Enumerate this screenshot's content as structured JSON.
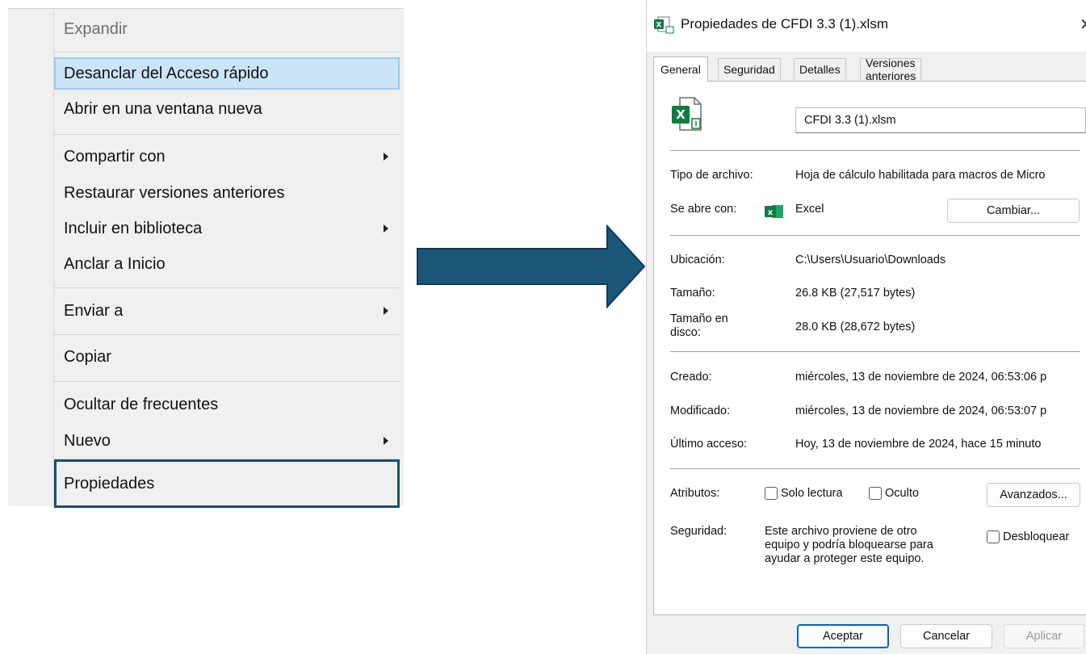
{
  "context_menu": {
    "items": [
      {
        "label": "Expandir"
      },
      {
        "label": "Desanclar del Acceso rápido"
      },
      {
        "label": "Abrir en una ventana nueva"
      },
      {
        "label": "Compartir con"
      },
      {
        "label": "Restaurar versiones anteriores"
      },
      {
        "label": "Incluir en biblioteca"
      },
      {
        "label": "Anclar a Inicio"
      },
      {
        "label": "Enviar a"
      },
      {
        "label": "Copiar"
      },
      {
        "label": "Ocultar de frecuentes"
      },
      {
        "label": "Nuevo"
      },
      {
        "label": "Propiedades"
      }
    ]
  },
  "dialog": {
    "title": "Propiedades de CFDI 3.3 (1).xlsm",
    "close_glyph": "✕",
    "tabs": [
      "General",
      "Seguridad",
      "Detalles",
      "Versiones anteriores"
    ],
    "filename": "CFDI 3.3 (1).xlsm",
    "file_type_label": "Tipo de archivo:",
    "file_type_value": "Hoja de cálculo habilitada para macros de Micro",
    "opens_with_label": "Se abre con:",
    "opens_with_value": "Excel",
    "change_button": "Cambiar...",
    "location_label": "Ubicación:",
    "location_value": "C:\\Users\\Usuario\\Downloads",
    "size_label": "Tamaño:",
    "size_value": "26.8 KB (27,517 bytes)",
    "size_on_disk_label": "Tamaño en disco:",
    "size_on_disk_value": "28.0 KB (28,672 bytes)",
    "created_label": "Creado:",
    "created_value": "miércoles, 13 de noviembre de 2024, 06:53:06 p",
    "modified_label": "Modificado:",
    "modified_value": "miércoles, 13 de noviembre de 2024, 06:53:07 p",
    "accessed_label": "Último acceso:",
    "accessed_value": "Hoy, 13 de noviembre de 2024, hace 15 minuto",
    "attributes_label": "Atributos:",
    "readonly_label": "Solo lectura",
    "hidden_label": "Oculto",
    "advanced_button": "Avanzados...",
    "security_label": "Seguridad:",
    "security_text_1": "Este archivo proviene de otro",
    "security_text_2": "equipo y podría bloquearse para",
    "security_text_3": "ayudar a proteger este equipo.",
    "unblock_label": "Desbloquear",
    "ok_button": "Aceptar",
    "cancel_button": "Cancelar",
    "apply_button": "Aplicar"
  },
  "colors": {
    "arrow": "#1b5679",
    "menu_hover": "#cce4f7",
    "excel_green": "#107c41",
    "highlight_border": "#1e4f6e"
  }
}
